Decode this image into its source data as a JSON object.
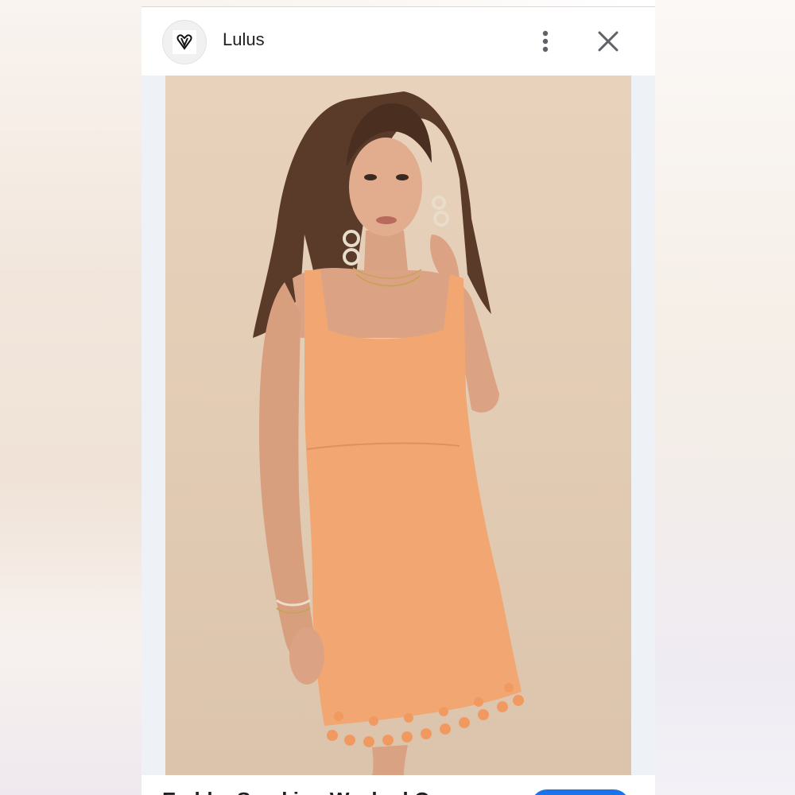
{
  "source": {
    "name": "Lulus",
    "logo_icon": "heart-v-logo-icon"
  },
  "header": {
    "more_icon": "more-vert-icon",
    "close_icon": "close-icon"
  },
  "image": {
    "subject": "orange-mini-dress-product-photo"
  },
  "lens": {
    "icon": "google-lens-icon"
  },
  "bottom": {
    "title_partial": "Embby Smoking Washed Orange"
  },
  "colors": {
    "dress": "#f2a671",
    "backdrop": "#e3ccb4",
    "accent_button": "#1a73e8",
    "lens_bg": "#3c3c3c"
  }
}
